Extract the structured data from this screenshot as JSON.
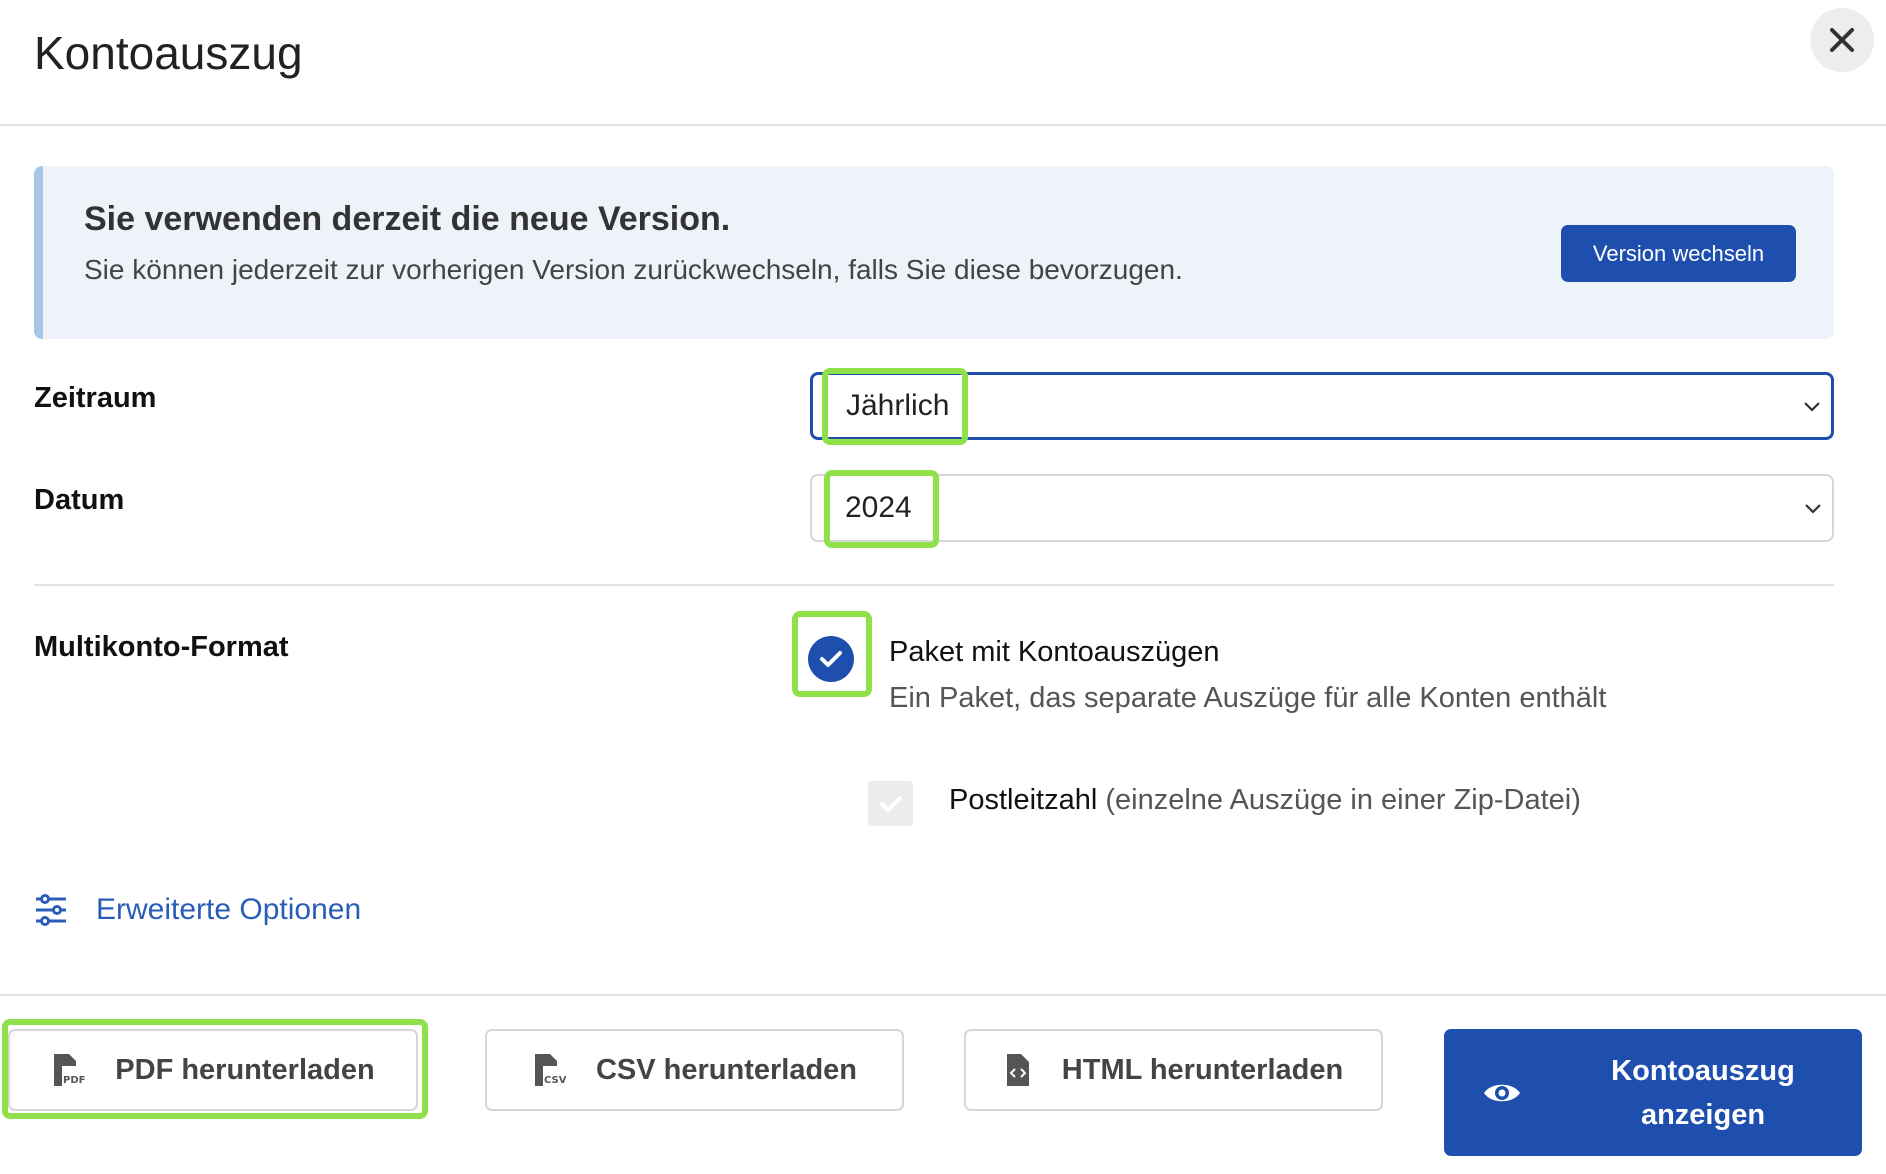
{
  "dialog": {
    "title": "Kontoauszug",
    "close_icon": "close-icon"
  },
  "banner": {
    "title": "Sie verwenden derzeit die neue Version.",
    "text": "Sie können jederzeit zur vorherigen Version zurückwechseln, falls Sie diese bevorzugen.",
    "button_label": "Version wechseln"
  },
  "form": {
    "period": {
      "label": "Zeitraum",
      "value": "Jährlich"
    },
    "date": {
      "label": "Datum",
      "value": "2024"
    },
    "multi_account": {
      "label": "Multikonto-Format",
      "option_title": "Paket mit Kontoauszügen",
      "option_desc": "Ein Paket, das separate Auszüge für alle Konten enthält",
      "option_selected": true,
      "zip_label_main": "Postleitzahl",
      "zip_label_note": " (einzelne Auszüge in einer Zip-Datei)",
      "zip_checked": false
    }
  },
  "advanced": {
    "label": "Erweiterte Optionen",
    "icon": "sliders-icon"
  },
  "footer": {
    "pdf_label": "PDF herunterladen",
    "csv_label": "CSV herunterladen",
    "html_label": "HTML herunterladen",
    "view_label_line1": "Kontoauszug",
    "view_label_line2": "anzeigen"
  },
  "colors": {
    "primary": "#1f4fae",
    "link": "#2a5db8",
    "highlight": "#8fe04a",
    "banner_bg": "#eef3fa",
    "banner_accent": "#a9c6e8"
  }
}
